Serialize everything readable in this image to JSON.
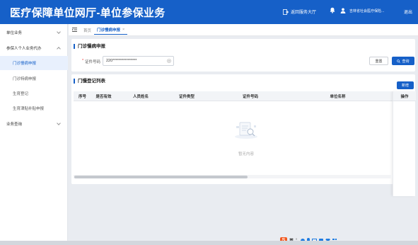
{
  "header": {
    "title": "医疗保障单位网厅-单位参保业务",
    "return_label": "返回服务大厅",
    "org_name": "吉林省社会医疗保险...",
    "logout_label": "退出"
  },
  "sidebar": {
    "items": [
      {
        "label": "单位业务",
        "level": 1
      },
      {
        "label": "参保人个人业务代办",
        "level": 1
      },
      {
        "label": "门诊慢病申报",
        "level": 2,
        "active": true
      },
      {
        "label": "门诊特病申报",
        "level": 2
      },
      {
        "label": "生育登记",
        "level": 2
      },
      {
        "label": "生育津贴补贴申报",
        "level": 2
      },
      {
        "label": "业务查询",
        "level": 1
      }
    ]
  },
  "tabs": {
    "home": "首页",
    "active": "门诊慢病申报",
    "close": "×"
  },
  "form": {
    "section_title": "门诊慢病申报",
    "required_mark": "*",
    "id_label": "证件号码",
    "id_value": "220****************",
    "reset_label": "重置",
    "query_label": "查询"
  },
  "list": {
    "section_title": "门慢登记列表",
    "add_label": "新增",
    "columns": [
      "序号",
      "是否有效",
      "人员姓名",
      "证件类型",
      "证件号码",
      "单位名称",
      "操作"
    ],
    "empty_text": "暂无内容"
  },
  "taskbar": {
    "ime_lang": "英"
  },
  "colors": {
    "brand": "#1660c8",
    "sidebar_active_bg": "#e8f0fd"
  }
}
